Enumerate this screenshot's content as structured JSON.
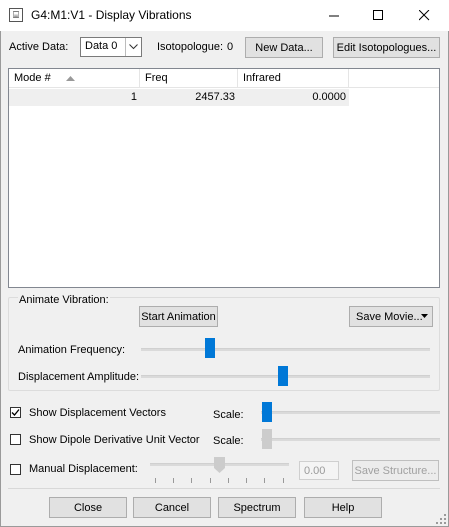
{
  "window": {
    "title": "G4:M1:V1 - Display Vibrations"
  },
  "top": {
    "active_data_label": "Active Data:",
    "active_data_value": "Data 0",
    "isotopologue_label": "Isotopologue:",
    "isotopologue_value": "0",
    "new_data_button": "New Data...",
    "edit_isotopologues_button": "Edit Isotopologues..."
  },
  "table": {
    "columns": [
      "Mode #",
      "Freq",
      "Infrared"
    ],
    "rows": [
      {
        "mode": "1",
        "freq": "2457.33",
        "infrared": "0.0000"
      }
    ]
  },
  "animate": {
    "group_label": "Animate Vibration:",
    "start_button": "Start Animation",
    "save_movie_button": "Save Movie...",
    "frequency_label": "Animation Frequency:",
    "frequency_level": 0.23,
    "amplitude_label": "Displacement Amplitude:",
    "amplitude_level": 0.49
  },
  "options": {
    "show_vectors_label": "Show Displacement Vectors",
    "show_vectors_checked": true,
    "show_dipole_label": "Show Dipole Derivative Unit Vector",
    "show_dipole_checked": false,
    "scale_label": "Scale:",
    "manual_label": "Manual Displacement:",
    "manual_checked": false,
    "manual_value": "0.00",
    "save_structure_button": "Save Structure..."
  },
  "bottom": {
    "close_button": "Close",
    "cancel_button": "Cancel",
    "spectrum_button": "Spectrum",
    "help_button": "Help"
  },
  "colors": {
    "accent": "#0078d7",
    "disabled": "#a0a0a0"
  },
  "icons": {
    "window": "app-icon",
    "minimize": "minimize-icon",
    "maximize": "maximize-icon",
    "close": "close-icon",
    "combo": "chevron-down-icon",
    "sort": "sort-up-icon"
  }
}
